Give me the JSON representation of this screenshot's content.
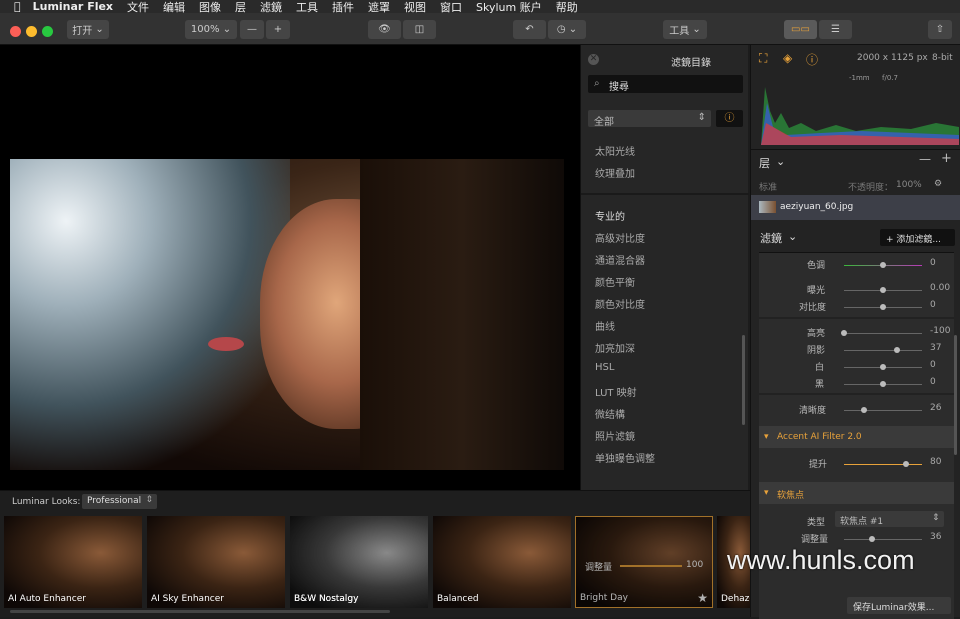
{
  "menubar": {
    "app": "Luminar Flex",
    "items": [
      "文件",
      "编辑",
      "图像",
      "层",
      "滤鏡",
      "工具",
      "插件",
      "遮罩",
      "视图",
      "窗口",
      "Skylum 账户",
      "帮助"
    ]
  },
  "toolbar": {
    "open": "打开",
    "zoom": "100%",
    "minus": "—",
    "plus": "+",
    "tools": "工具"
  },
  "filters": {
    "title": "滤鏡目錄",
    "search_placeholder": "搜尋",
    "category": "全部",
    "items_top": [
      "太阳光线",
      "纹理叠加"
    ],
    "section": "专业的",
    "items": [
      "高级对比度",
      "通道混合器",
      "颜色平衡",
      "颜色对比度",
      "曲线",
      "加亮加深",
      "HSL",
      "LUT 映射",
      "微结構",
      "照片滤鏡",
      "单独曝色调整"
    ]
  },
  "info": {
    "size": "2000 x 1125 px",
    "depth": "8-bit",
    "lens": "-1mm",
    "aperture": "f/0.7"
  },
  "layers": {
    "title": "层",
    "blend": "标准",
    "opacity_label": "不透明度：",
    "opacity": "100%",
    "layer_name": "aeziyuan_60.jpg"
  },
  "filter_section": {
    "title": "滤鏡",
    "add": "+ 添加滤鏡..."
  },
  "adjust": [
    {
      "label": "色调",
      "value": "0",
      "pos": 0.5
    },
    {
      "label": "曝光",
      "value": "0.00",
      "pos": 0.5
    },
    {
      "label": "对比度",
      "value": "0",
      "pos": 0.5
    },
    {
      "label": "高亮",
      "value": "-100",
      "pos": 0.0
    },
    {
      "label": "阴影",
      "value": "37",
      "pos": 0.68
    },
    {
      "label": "白",
      "value": "0",
      "pos": 0.5
    },
    {
      "label": "黑",
      "value": "0",
      "pos": 0.5
    },
    {
      "label": "清晰度",
      "value": "26",
      "pos": 0.26
    }
  ],
  "accent": {
    "title": "Accent AI Filter 2.0",
    "label": "提升",
    "value": "80",
    "pos": 0.8
  },
  "soft": {
    "title": "软焦点",
    "type_label": "类型",
    "type_value": "软焦点 #1",
    "amount_label": "调整量",
    "amount_value": "36",
    "amount_pos": 0.36
  },
  "save": "保存Luminar效果...",
  "looks": {
    "label": "Luminar Looks:",
    "category": "Professional",
    "thumbs": [
      "AI Auto Enhancer",
      "AI Sky Enhancer",
      "B&W Nostalgy",
      "Balanced",
      "Bright Day",
      "Dehaze"
    ],
    "overlay_label": "调整量",
    "overlay_value": "100"
  },
  "watermark": "www.hunls.com"
}
